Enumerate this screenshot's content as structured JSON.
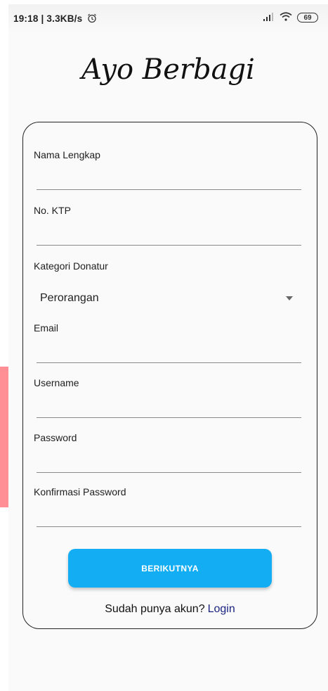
{
  "status_bar": {
    "time_speed": "19:18 | 3.3KB/s",
    "battery": "69"
  },
  "app_title": "Ayo Berbagi",
  "form": {
    "full_name_label": "Nama Lengkap",
    "ktp_label": "No. KTP",
    "category_label": "Kategori Donatur",
    "category_selected": "Perorangan",
    "email_label": "Email",
    "username_label": "Username",
    "password_label": "Password",
    "confirm_password_label": "Konfirmasi Password"
  },
  "next_button": "BERIKUTNYA",
  "footer": {
    "prompt": "Sudah punya akun?",
    "login_link": "Login"
  },
  "colors": {
    "button": "#13adf3",
    "login_link": "#1a237e",
    "side_accent": "#ff8f94"
  }
}
